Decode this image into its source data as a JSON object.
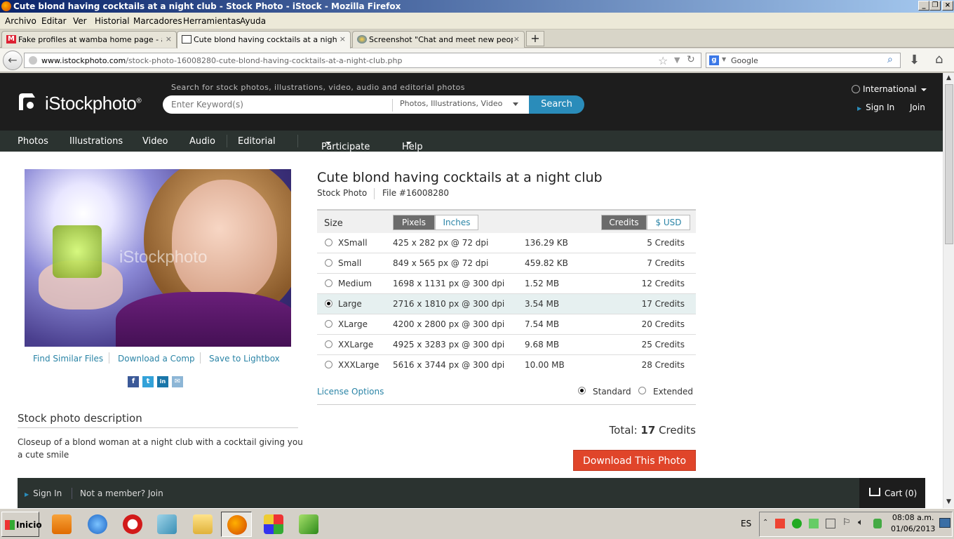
{
  "window": {
    "title": "Cute blond having cocktails at a night club - Stock Photo - iStock - Mozilla Firefox"
  },
  "menu": [
    "Archivo",
    "Editar",
    "Ver",
    "Historial",
    "Marcadores",
    "Herramientas",
    "Ayuda"
  ],
  "tabs": [
    {
      "label": "Fake profiles at wamba home page - ard...",
      "close": "×"
    },
    {
      "label": "Cute blond having cocktails at a night clu...",
      "close": "×"
    },
    {
      "label": "Screenshot \"Chat and meet new people, ...",
      "close": "×"
    }
  ],
  "newtab": "+",
  "nav": {
    "back": "←",
    "url_domain": "www.istockphoto.com",
    "url_path": "/stock-photo-16008280-cute-blond-having-cocktails-at-a-night-club.php",
    "search_engine": "Google",
    "search_placeholder": "Google"
  },
  "site": {
    "logo": "iStockphoto",
    "logo_reg": "®",
    "search_hint": "Search for stock photos, illustrations, video, audio and editorial photos",
    "keyword_placeholder": "Enter Keyword(s)",
    "search_type": "Photos, Illustrations, Video",
    "search_button": "Search",
    "international": "International",
    "sign_in": "Sign In",
    "join": "Join",
    "nav": [
      "Photos",
      "Illustrations",
      "Video",
      "Audio",
      "Editorial",
      "Participate",
      "Help"
    ]
  },
  "photo": {
    "watermark": "iStockphoto",
    "links": [
      "Find Similar Files",
      "Download a Comp",
      "Save to Lightbox"
    ],
    "social": [
      "f",
      "t",
      "in",
      "✉"
    ]
  },
  "description": {
    "title": "Stock photo description",
    "text": "Closeup of a blond woman at a night club with a cocktail giving you a cute smile"
  },
  "detail": {
    "title": "Cute blond having cocktails at a night club",
    "type": "Stock Photo",
    "file": "File #16008280",
    "size_label": "Size",
    "unit_toggle": [
      "Pixels",
      "Inches"
    ],
    "price_toggle": [
      "Credits",
      "$ USD"
    ],
    "sizes": [
      {
        "name": "XSmall",
        "dims": "425 x 282 px @ 72 dpi",
        "file_size": "136.29 KB",
        "price": "5 Credits",
        "selected": false
      },
      {
        "name": "Small",
        "dims": "849 x 565 px @ 72 dpi",
        "file_size": "459.82 KB",
        "price": "7 Credits",
        "selected": false
      },
      {
        "name": "Medium",
        "dims": "1698 x 1131 px @ 300 dpi",
        "file_size": "1.52 MB",
        "price": "12 Credits",
        "selected": false
      },
      {
        "name": "Large",
        "dims": "2716 x 1810 px @ 300 dpi",
        "file_size": "3.54 MB",
        "price": "17 Credits",
        "selected": true
      },
      {
        "name": "XLarge",
        "dims": "4200 x 2800 px @ 300 dpi",
        "file_size": "7.54 MB",
        "price": "20 Credits",
        "selected": false
      },
      {
        "name": "XXLarge",
        "dims": "4925 x 3283 px @ 300 dpi",
        "file_size": "9.68 MB",
        "price": "25 Credits",
        "selected": false
      },
      {
        "name": "XXXLarge",
        "dims": "5616 x 3744 px @ 300 dpi",
        "file_size": "10.00 MB",
        "price": "28 Credits",
        "selected": false
      }
    ],
    "license_options": "License Options",
    "license_standard": "Standard",
    "license_extended": "Extended",
    "total_label": "Total:",
    "total_value": "17",
    "total_unit": "Credits",
    "download_button": "Download This Photo"
  },
  "footer": {
    "sign_in": "Sign In",
    "not_member": "Not a member? Join",
    "cart": "Cart (0)"
  },
  "taskbar": {
    "start": "Inicio",
    "lang": "ES",
    "time": "08:08 a.m.",
    "date": "01/06/2013"
  },
  "colors": {
    "accent": "#2a84a6",
    "search_btn": "#2a8cba",
    "download_btn": "#e0452a",
    "header_bg": "#1d1d1d",
    "nav_bg": "#2b3330"
  }
}
